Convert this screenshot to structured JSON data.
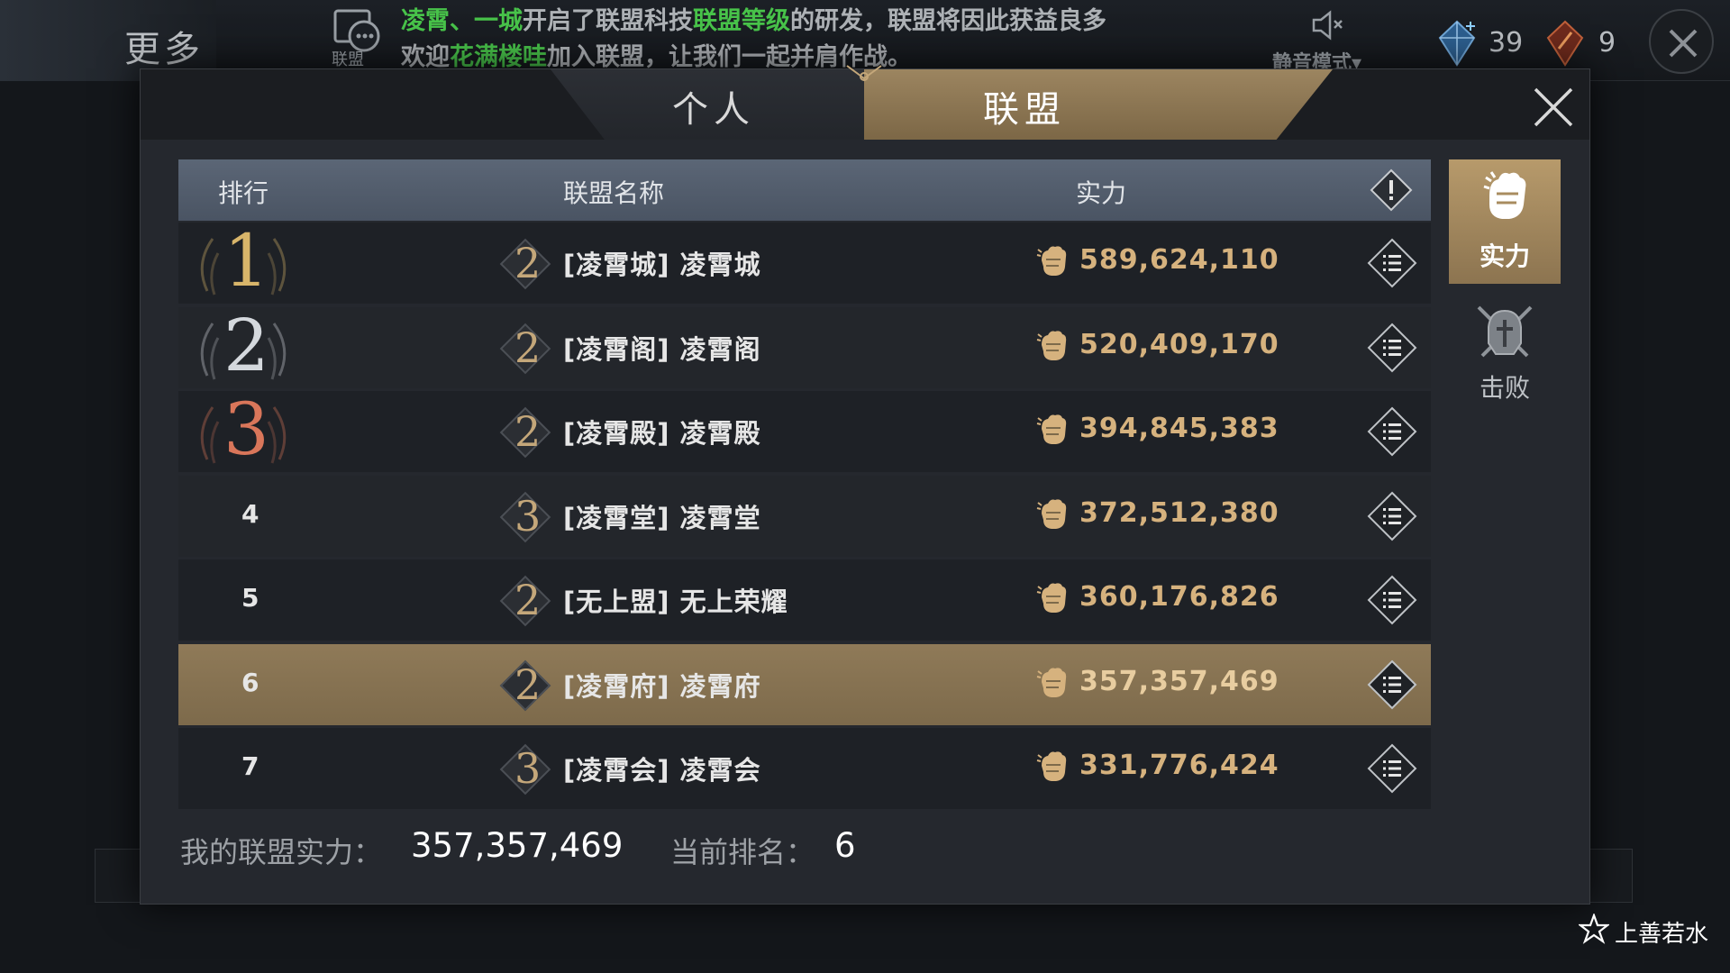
{
  "topbar": {
    "more_label": "更多",
    "chat_label": "联盟",
    "news_line1": {
      "p1": "凌霄、一城",
      "p2": "开启了联盟科技",
      "p3": "联盟等级",
      "p4": "的研发，联盟将因此获益良多"
    },
    "news_line2": {
      "p1": "欢迎",
      "p2": "花满楼哇",
      "p3": "加入联盟，让我们一起并肩作战。"
    },
    "mute_label": "静音模式▾",
    "gem_count": "39",
    "token_count": "9"
  },
  "tabs": {
    "personal": "个人",
    "alliance": "联盟",
    "active": "alliance"
  },
  "table": {
    "headers": {
      "rank": "排行",
      "name": "联盟名称",
      "power": "实力"
    },
    "rows": [
      {
        "rank": "1",
        "level": "2",
        "name": "[凌霄城] 凌霄城",
        "power": "589,624,110"
      },
      {
        "rank": "2",
        "level": "2",
        "name": "[凌霄阁] 凌霄阁",
        "power": "520,409,170"
      },
      {
        "rank": "3",
        "level": "2",
        "name": "[凌霄殿] 凌霄殿",
        "power": "394,845,383"
      },
      {
        "rank": "4",
        "level": "3",
        "name": "[凌霄堂] 凌霄堂",
        "power": "372,512,380"
      },
      {
        "rank": "5",
        "level": "2",
        "name": "[无上盟] 无上荣耀",
        "power": "360,176,826"
      },
      {
        "rank": "6",
        "level": "2",
        "name": "[凌霄府] 凌霄府",
        "power": "357,357,469"
      },
      {
        "rank": "7",
        "level": "3",
        "name": "[凌霄会] 凌霄会",
        "power": "331,776,424"
      }
    ],
    "highlight_rank": "6"
  },
  "side_tabs": {
    "power": "实力",
    "defeat": "击败"
  },
  "footer": {
    "my_power_label": "我的联盟实力：",
    "my_power_value": "357,357,469",
    "current_rank_label": "当前排名：",
    "current_rank_value": "6"
  },
  "watermark": "上善若水",
  "colors": {
    "gold": "#d6b27e",
    "active_tab": "#9c8560",
    "highlight_row": "#8f7a58",
    "news_green": "#48c34a"
  }
}
